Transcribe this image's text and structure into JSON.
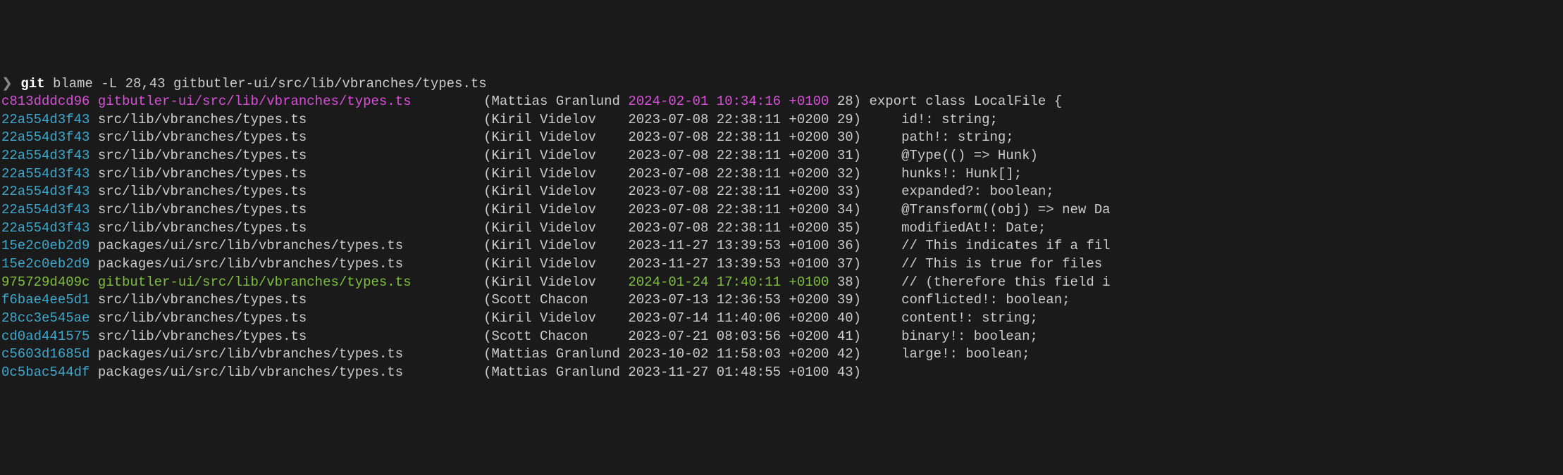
{
  "prompt": {
    "chevron": "❯",
    "cmd_git": "git",
    "cmd_rest": " blame -L 28,43 gitbutler-ui/src/lib/vbranches/types.ts"
  },
  "widths": {
    "sha": 11,
    "path": 47,
    "author": 17,
    "date": 10,
    "time": 8,
    "tz": 5,
    "lineno": 2
  },
  "rows": [
    {
      "age": "new",
      "sha": "c813dddcd96",
      "path": "gitbutler-ui/src/lib/vbranches/types.ts",
      "author": "Mattias Granlund",
      "date": "2024-02-01",
      "time": "10:34:16",
      "tz": "+0100",
      "lineno": 28,
      "code": "export class LocalFile {"
    },
    {
      "age": "old",
      "sha": "22a554d3f43",
      "path": "src/lib/vbranches/types.ts",
      "author": "Kiril Videlov",
      "date": "2023-07-08",
      "time": "22:38:11",
      "tz": "+0200",
      "lineno": 29,
      "code": "    id!: string;"
    },
    {
      "age": "old",
      "sha": "22a554d3f43",
      "path": "src/lib/vbranches/types.ts",
      "author": "Kiril Videlov",
      "date": "2023-07-08",
      "time": "22:38:11",
      "tz": "+0200",
      "lineno": 30,
      "code": "    path!: string;"
    },
    {
      "age": "old",
      "sha": "22a554d3f43",
      "path": "src/lib/vbranches/types.ts",
      "author": "Kiril Videlov",
      "date": "2023-07-08",
      "time": "22:38:11",
      "tz": "+0200",
      "lineno": 31,
      "code": "    @Type(() => Hunk)"
    },
    {
      "age": "old",
      "sha": "22a554d3f43",
      "path": "src/lib/vbranches/types.ts",
      "author": "Kiril Videlov",
      "date": "2023-07-08",
      "time": "22:38:11",
      "tz": "+0200",
      "lineno": 32,
      "code": "    hunks!: Hunk[];"
    },
    {
      "age": "old",
      "sha": "22a554d3f43",
      "path": "src/lib/vbranches/types.ts",
      "author": "Kiril Videlov",
      "date": "2023-07-08",
      "time": "22:38:11",
      "tz": "+0200",
      "lineno": 33,
      "code": "    expanded?: boolean;"
    },
    {
      "age": "old",
      "sha": "22a554d3f43",
      "path": "src/lib/vbranches/types.ts",
      "author": "Kiril Videlov",
      "date": "2023-07-08",
      "time": "22:38:11",
      "tz": "+0200",
      "lineno": 34,
      "code": "    @Transform((obj) => new Da"
    },
    {
      "age": "old",
      "sha": "22a554d3f43",
      "path": "src/lib/vbranches/types.ts",
      "author": "Kiril Videlov",
      "date": "2023-07-08",
      "time": "22:38:11",
      "tz": "+0200",
      "lineno": 35,
      "code": "    modifiedAt!: Date;"
    },
    {
      "age": "old",
      "sha": "15e2c0eb2d9",
      "path": "packages/ui/src/lib/vbranches/types.ts",
      "author": "Kiril Videlov",
      "date": "2023-11-27",
      "time": "13:39:53",
      "tz": "+0100",
      "lineno": 36,
      "code": "    // This indicates if a fil"
    },
    {
      "age": "old",
      "sha": "15e2c0eb2d9",
      "path": "packages/ui/src/lib/vbranches/types.ts",
      "author": "Kiril Videlov",
      "date": "2023-11-27",
      "time": "13:39:53",
      "tz": "+0100",
      "lineno": 37,
      "code": "    // This is true for files "
    },
    {
      "age": "recent",
      "sha": "975729d409c",
      "path": "gitbutler-ui/src/lib/vbranches/types.ts",
      "author": "Kiril Videlov",
      "date": "2024-01-24",
      "time": "17:40:11",
      "tz": "+0100",
      "lineno": 38,
      "code": "    // (therefore this field i"
    },
    {
      "age": "old",
      "sha": "f6bae4ee5d1",
      "path": "src/lib/vbranches/types.ts",
      "author": "Scott Chacon",
      "date": "2023-07-13",
      "time": "12:36:53",
      "tz": "+0200",
      "lineno": 39,
      "code": "    conflicted!: boolean;"
    },
    {
      "age": "old",
      "sha": "28cc3e545ae",
      "path": "src/lib/vbranches/types.ts",
      "author": "Kiril Videlov",
      "date": "2023-07-14",
      "time": "11:40:06",
      "tz": "+0200",
      "lineno": 40,
      "code": "    content!: string;"
    },
    {
      "age": "old",
      "sha": "cd0ad441575",
      "path": "src/lib/vbranches/types.ts",
      "author": "Scott Chacon",
      "date": "2023-07-21",
      "time": "08:03:56",
      "tz": "+0200",
      "lineno": 41,
      "code": "    binary!: boolean;"
    },
    {
      "age": "old",
      "sha": "c5603d1685d",
      "path": "packages/ui/src/lib/vbranches/types.ts",
      "author": "Mattias Granlund",
      "date": "2023-10-02",
      "time": "11:58:03",
      "tz": "+0200",
      "lineno": 42,
      "code": "    large!: boolean;"
    },
    {
      "age": "old",
      "sha": "0c5bac544df",
      "path": "packages/ui/src/lib/vbranches/types.ts",
      "author": "Mattias Granlund",
      "date": "2023-11-27",
      "time": "01:48:55",
      "tz": "+0100",
      "lineno": 43,
      "code": ""
    }
  ]
}
